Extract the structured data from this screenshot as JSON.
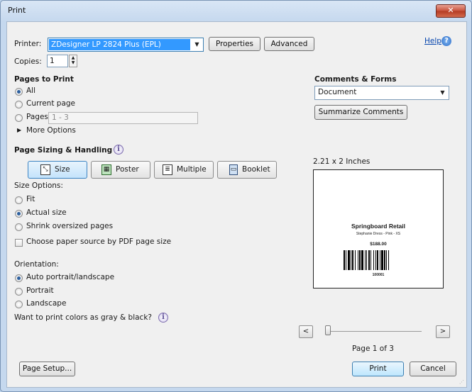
{
  "window": {
    "title": "Print",
    "close_glyph": "✕"
  },
  "printer": {
    "label": "Printer:",
    "selected": "ZDesigner LP 2824 Plus (EPL)",
    "properties_button": "Properties",
    "advanced_button": "Advanced",
    "help_link": "Help",
    "help_icon_glyph": "?"
  },
  "copies": {
    "label": "Copies:",
    "value": "1"
  },
  "pages_to_print": {
    "heading": "Pages to Print",
    "all_label": "All",
    "current_page_label": "Current page",
    "pages_label": "Pages",
    "pages_value": "1 - 3",
    "more_options_label": "More Options",
    "selected": "all"
  },
  "page_sizing": {
    "heading": "Page Sizing & Handling",
    "info_glyph": "i",
    "buttons": [
      {
        "label": "Size",
        "icon": "size-icon"
      },
      {
        "label": "Poster",
        "icon": "poster-icon"
      },
      {
        "label": "Multiple",
        "icon": "multiple-icon"
      },
      {
        "label": "Booklet",
        "icon": "booklet-icon"
      }
    ],
    "active": "Size",
    "size_options_label": "Size Options:",
    "fit_label": "Fit",
    "actual_size_label": "Actual size",
    "shrink_label": "Shrink oversized pages",
    "size_selected": "actual-size",
    "paper_source_label": "Choose paper source by PDF page size",
    "paper_source_checked": false
  },
  "orientation": {
    "label": "Orientation:",
    "auto_label": "Auto portrait/landscape",
    "portrait_label": "Portrait",
    "landscape_label": "Landscape",
    "selected": "auto"
  },
  "grayscale": {
    "label": "Want to print colors as gray & black?",
    "info_glyph": "i"
  },
  "comments_forms": {
    "heading": "Comments & Forms",
    "selected": "Document",
    "summarize_button": "Summarize Comments"
  },
  "preview": {
    "size_text": "2.21 x 2 Inches",
    "label_company": "Springboard Retail",
    "label_product": "Stephanie Dress - Pink - XS",
    "label_price": "$188.00",
    "label_barcode_number": "100001",
    "prev_glyph": "<",
    "next_glyph": ">",
    "page_indicator": "Page 1 of 3",
    "slider_position_fraction": 0.0
  },
  "footer": {
    "page_setup_button": "Page Setup...",
    "print_button": "Print",
    "cancel_button": "Cancel"
  },
  "colors": {
    "selection_blue": "#3399ff",
    "active_radio": "#2c5f9e",
    "help_link": "#0645ad"
  }
}
